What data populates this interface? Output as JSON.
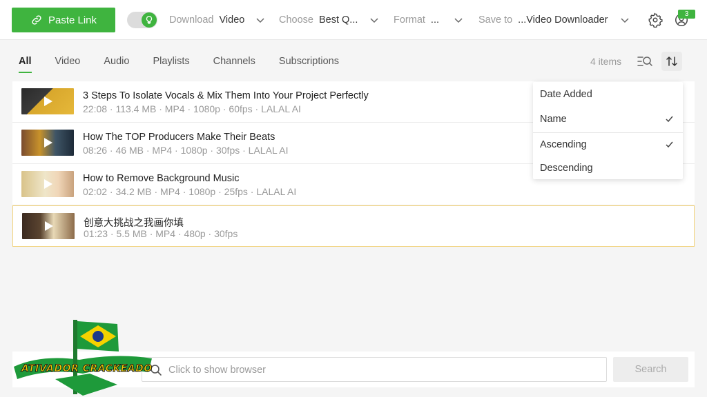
{
  "toolbar": {
    "paste_label": "Paste Link",
    "download": {
      "label": "Download",
      "value": "Video"
    },
    "choose": {
      "label": "Choose",
      "value": "Best Q..."
    },
    "format": {
      "label": "Format",
      "value": "..."
    },
    "save_to": {
      "label": "Save to",
      "value": "...Video Downloader"
    },
    "notification_count": "3",
    "accent_color": "#3fb43f"
  },
  "tabs": [
    {
      "label": "All",
      "active": true
    },
    {
      "label": "Video",
      "active": false
    },
    {
      "label": "Audio",
      "active": false
    },
    {
      "label": "Playlists",
      "active": false
    },
    {
      "label": "Channels",
      "active": false
    },
    {
      "label": "Subscriptions",
      "active": false
    }
  ],
  "item_count": "4 items",
  "items": [
    {
      "title": "3 Steps To Isolate Vocals & Mix Them Into Your Project Perfectly",
      "meta": "22:08 · 113.4 MB · MP4 · 1080p · 60fps · LALAL AI",
      "selected": false
    },
    {
      "title": "How The TOP Producers Make Their Beats",
      "meta": "08:26 · 46 MB · MP4 · 1080p · 30fps · LALAL AI",
      "selected": false
    },
    {
      "title": "How to Remove Background Music",
      "meta": "02:02 · 34.2 MB · MP4 · 1080p · 25fps · LALAL AI",
      "selected": false
    },
    {
      "title": "创意大挑战之我画你填",
      "meta": "01:23 · 5.5 MB · MP4 · 480p · 30fps",
      "selected": true
    }
  ],
  "sort_menu": {
    "items": [
      {
        "label": "Date Added",
        "checked": false
      },
      {
        "label": "Name",
        "checked": true
      },
      {
        "label": "Ascending",
        "checked": true
      },
      {
        "label": "Descending",
        "checked": false
      }
    ]
  },
  "search": {
    "placeholder": "Click to show browser",
    "button_label": "Search"
  },
  "watermark": {
    "text": "ATIVADOR CRACKEADO"
  }
}
